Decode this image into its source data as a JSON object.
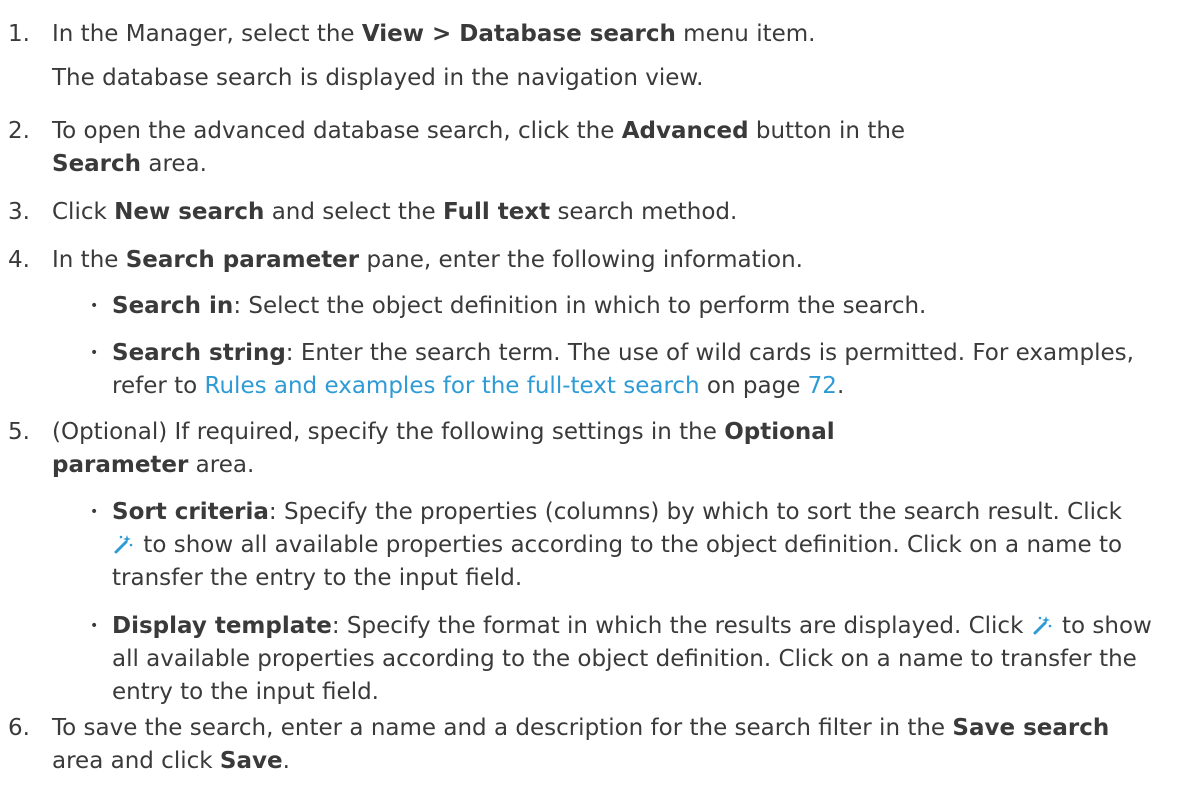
{
  "steps": [
    {
      "num": "1.",
      "pre": "In the Manager, select the ",
      "b1": "View > Database search",
      "post": " menu item.",
      "note": "The database search is displayed in the navigation view."
    },
    {
      "num": "2.",
      "pre": "To open the advanced database search, click the ",
      "b1": "Advanced",
      "mid": " button in the",
      "b2": "Search",
      "post": " area."
    },
    {
      "num": "3.",
      "pre": "Click ",
      "b1": "New search",
      "mid": " and select the ",
      "b2": "Full text",
      "post": " search method."
    },
    {
      "num": "4.",
      "pre": "In the ",
      "b1": "Search parameter",
      "post": " pane, enter the following information.",
      "bullets": [
        {
          "term": "Search in",
          "text": ": Select the object definition in which to perform the search."
        },
        {
          "term": "Search string",
          "text": ": Enter the search term. The use of wild cards is permitted. For examples, refer to ",
          "link": "Rules and examples for the full-text search",
          "text2": " on page ",
          "page": "72",
          "end": "."
        }
      ]
    },
    {
      "num": "5.",
      "pre": "(Optional) If required, specify the following settings in the ",
      "b1": "Optional",
      "b2": "parameter",
      "post": " area.",
      "bullets": [
        {
          "term": "Sort criteria",
          "text": ": Specify the properties (columns) by which to sort the search result. Click ",
          "icon": "magic-wand-icon",
          "text2": " to show all available properties according to the object definition. Click on a name to transfer the entry to the input field."
        },
        {
          "term": "Display template",
          "text": ": Specify the format in which the results are displayed. Click ",
          "icon": "magic-wand-icon",
          "text2": " to show all available properties according to the object definition. Click on a name to transfer the entry to the input field."
        }
      ]
    },
    {
      "num": "6.",
      "pre": "To save the search, enter a name and a description for the search filter in the ",
      "b1": "Save search",
      "mid": " area and click ",
      "b2": "Save",
      "post": "."
    }
  ],
  "colors": {
    "text": "#3a3a3a",
    "link": "#2e9bd6",
    "icon": "#2e9bd6"
  }
}
